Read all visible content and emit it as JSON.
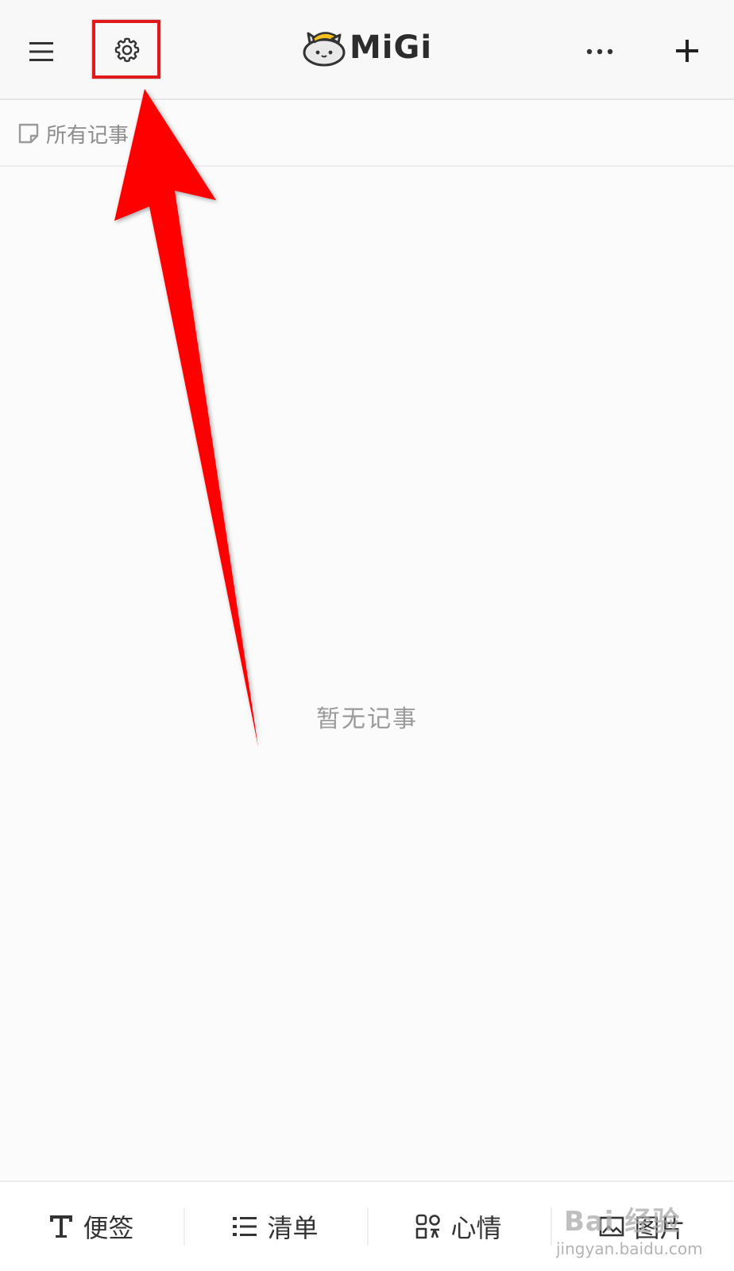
{
  "app": {
    "logo_text": "MiGi"
  },
  "header": {
    "menu_icon": "hamburger-menu-icon",
    "settings_icon": "gear-icon",
    "more_icon": "ellipsis-icon",
    "add_icon": "plus-icon"
  },
  "filter": {
    "label": "所有记事",
    "icon": "note-icon"
  },
  "main": {
    "empty_text": "暂无记事"
  },
  "bottom_tabs": [
    {
      "label": "便签",
      "icon": "text-T-icon"
    },
    {
      "label": "清单",
      "icon": "list-icon"
    },
    {
      "label": "心情",
      "icon": "mood-grid-icon"
    },
    {
      "label": "图片",
      "icon": "image-icon"
    }
  ],
  "watermark": {
    "main": "Bai 经验",
    "sub": "jingyan.baidu.com"
  },
  "annotation": {
    "highlight_color": "#e01a1a",
    "arrow_color": "#ff0000"
  }
}
